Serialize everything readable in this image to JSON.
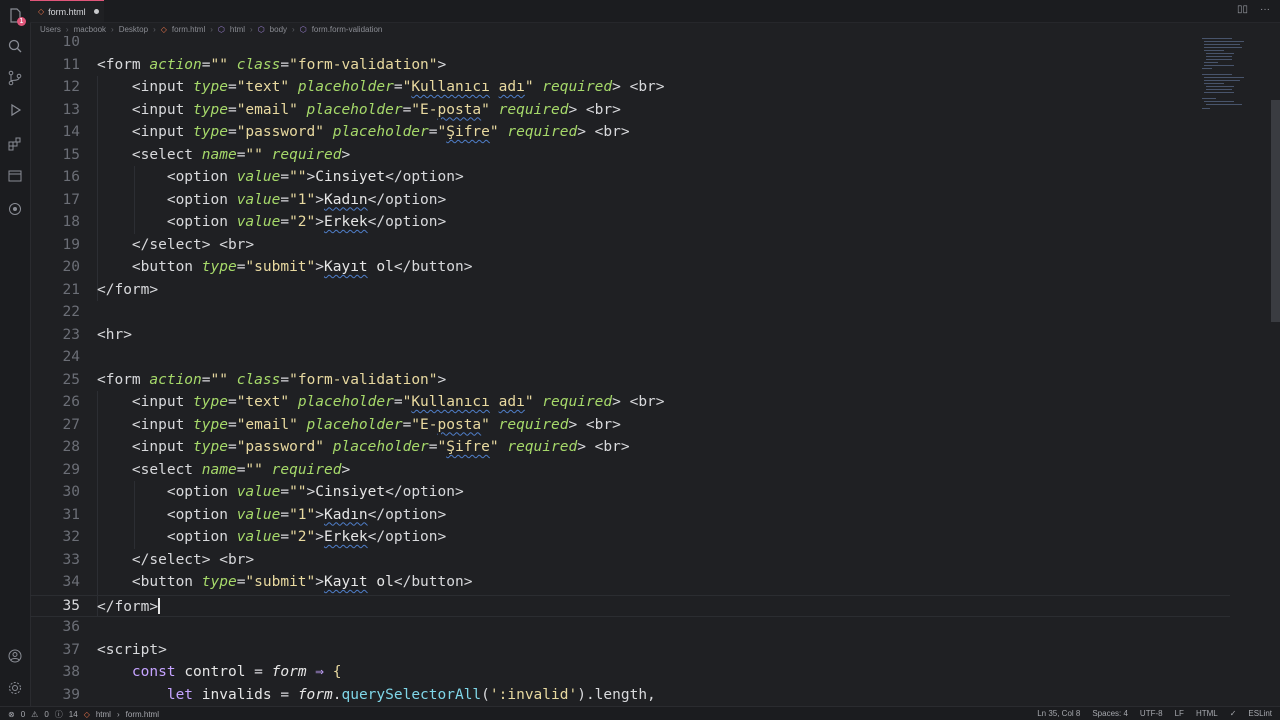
{
  "tab": {
    "filename": "form.html",
    "file_icon": "html-file-icon"
  },
  "breadcrumb": [
    "Users",
    "macbook",
    "Desktop",
    "form.html",
    "html",
    "body",
    "form.form-validation"
  ],
  "editor": {
    "lines": [
      {
        "n": "10",
        "html": ""
      },
      {
        "n": "11",
        "html": "<span class='t-tag'>&lt;form </span><span class='t-attr'>action</span><span class='t-punct'>=</span><span class='t-str'>\"\"</span> <span class='t-attr'>class</span><span class='t-punct'>=</span><span class='t-str'>\"form-validation\"</span><span class='t-tag'>&gt;</span>"
      },
      {
        "n": "12",
        "html": "    <span class='t-tag'>&lt;input </span><span class='t-attr'>type</span>=<span class='t-str'>\"text\"</span> <span class='t-attr'>placeholder</span>=<span class='t-str'>\"<span class='squiggle'>Kullanıcı</span> <span class='squiggle'>adı</span>\"</span> <span class='t-attr'>required</span><span class='t-tag'>&gt; &lt;br&gt;</span>"
      },
      {
        "n": "13",
        "html": "    <span class='t-tag'>&lt;input </span><span class='t-attr'>type</span>=<span class='t-str'>\"email\"</span> <span class='t-attr'>placeholder</span>=<span class='t-str'>\"E-<span class='squiggle'>posta</span>\"</span> <span class='t-attr'>required</span><span class='t-tag'>&gt; &lt;br&gt;</span>"
      },
      {
        "n": "14",
        "html": "    <span class='t-tag'>&lt;input </span><span class='t-attr'>type</span>=<span class='t-str'>\"password\"</span> <span class='t-attr'>placeholder</span>=<span class='t-str'>\"<span class='squiggle'>Şifre</span>\"</span> <span class='t-attr'>required</span><span class='t-tag'>&gt; &lt;br&gt;</span>"
      },
      {
        "n": "15",
        "html": "    <span class='t-tag'>&lt;select </span><span class='t-attr'>name</span>=<span class='t-str'>\"\"</span> <span class='t-attr'>required</span><span class='t-tag'>&gt;</span>"
      },
      {
        "n": "16",
        "html": "        <span class='t-tag'>&lt;option </span><span class='t-attr'>value</span>=<span class='t-str'>\"\"</span><span class='t-tag'>&gt;</span><span class='t-text'>Cinsiyet</span><span class='t-tag'>&lt;/option&gt;</span>"
      },
      {
        "n": "17",
        "html": "        <span class='t-tag'>&lt;option </span><span class='t-attr'>value</span>=<span class='t-str'>\"1\"</span><span class='t-tag'>&gt;</span><span class='t-text squiggle'>Kadın</span><span class='t-tag'>&lt;/option&gt;</span>"
      },
      {
        "n": "18",
        "html": "        <span class='t-tag'>&lt;option </span><span class='t-attr'>value</span>=<span class='t-str'>\"2\"</span><span class='t-tag'>&gt;</span><span class='t-text squiggle'>Erkek</span><span class='t-tag'>&lt;/option&gt;</span>"
      },
      {
        "n": "19",
        "html": "    <span class='t-tag'>&lt;/select&gt; &lt;br&gt;</span>"
      },
      {
        "n": "20",
        "html": "    <span class='t-tag'>&lt;button </span><span class='t-attr'>type</span>=<span class='t-str'>\"submit\"</span><span class='t-tag'>&gt;</span><span class='t-text'><span class='squiggle'>Kayıt</span> ol</span><span class='t-tag'>&lt;/button&gt;</span>"
      },
      {
        "n": "21",
        "html": "<span class='t-tag'>&lt;/form&gt;</span>"
      },
      {
        "n": "22",
        "html": ""
      },
      {
        "n": "23",
        "html": "<span class='t-tag'>&lt;hr&gt;</span>"
      },
      {
        "n": "24",
        "html": ""
      },
      {
        "n": "25",
        "html": "<span class='t-tag'>&lt;form </span><span class='t-attr'>action</span><span class='t-punct'>=</span><span class='t-str'>\"\"</span> <span class='t-attr'>class</span><span class='t-punct'>=</span><span class='t-str'>\"form-validation\"</span><span class='t-tag'>&gt;</span>"
      },
      {
        "n": "26",
        "html": "    <span class='t-tag'>&lt;input </span><span class='t-attr'>type</span>=<span class='t-str'>\"text\"</span> <span class='t-attr'>placeholder</span>=<span class='t-str'>\"<span class='squiggle'>Kullanıcı</span> <span class='squiggle'>adı</span>\"</span> <span class='t-attr'>required</span><span class='t-tag'>&gt; &lt;br&gt;</span>"
      },
      {
        "n": "27",
        "html": "    <span class='t-tag'>&lt;input </span><span class='t-attr'>type</span>=<span class='t-str'>\"email\"</span> <span class='t-attr'>placeholder</span>=<span class='t-str'>\"E-<span class='squiggle'>posta</span>\"</span> <span class='t-attr'>required</span><span class='t-tag'>&gt; &lt;br&gt;</span>"
      },
      {
        "n": "28",
        "html": "    <span class='t-tag'>&lt;input </span><span class='t-attr'>type</span>=<span class='t-str'>\"password\"</span> <span class='t-attr'>placeholder</span>=<span class='t-str'>\"<span class='squiggle'>Şifre</span>\"</span> <span class='t-attr'>required</span><span class='t-tag'>&gt; &lt;br&gt;</span>"
      },
      {
        "n": "29",
        "html": "    <span class='t-tag'>&lt;select </span><span class='t-attr'>name</span>=<span class='t-str'>\"\"</span> <span class='t-attr'>required</span><span class='t-tag'>&gt;</span>"
      },
      {
        "n": "30",
        "html": "        <span class='t-tag'>&lt;option </span><span class='t-attr'>value</span>=<span class='t-str'>\"\"</span><span class='t-tag'>&gt;</span><span class='t-text'>Cinsiyet</span><span class='t-tag'>&lt;/option&gt;</span>"
      },
      {
        "n": "31",
        "html": "        <span class='t-tag'>&lt;option </span><span class='t-attr'>value</span>=<span class='t-str'>\"1\"</span><span class='t-tag'>&gt;</span><span class='t-text squiggle'>Kadın</span><span class='t-tag'>&lt;/option&gt;</span>"
      },
      {
        "n": "32",
        "html": "        <span class='t-tag'>&lt;option </span><span class='t-attr'>value</span>=<span class='t-str'>\"2\"</span><span class='t-tag'>&gt;</span><span class='t-text squiggle'>Erkek</span><span class='t-tag'>&lt;/option&gt;</span>"
      },
      {
        "n": "33",
        "html": "    <span class='t-tag'>&lt;/select&gt; &lt;br&gt;</span>"
      },
      {
        "n": "34",
        "html": "    <span class='t-tag'>&lt;button </span><span class='t-attr'>type</span>=<span class='t-str'>\"submit\"</span><span class='t-tag'>&gt;</span><span class='t-text'><span class='squiggle'>Kayıt</span> ol</span><span class='t-tag'>&lt;/button&gt;</span>"
      },
      {
        "n": "35",
        "html": "<span class='t-tag'>&lt;/form&gt;</span><span class='cursor'></span>",
        "current": true
      },
      {
        "n": "36",
        "html": ""
      },
      {
        "n": "37",
        "html": "<span class='t-tag'>&lt;script&gt;</span>"
      },
      {
        "n": "38",
        "html": "    <span class='t-kw'>const</span> <span class='t-var'>control</span> <span class='t-punct'>=</span> <span class='t-it'>form</span> <span class='t-kw'>⇒</span> <span class='t-str'>{</span>"
      },
      {
        "n": "39",
        "html": "        <span class='t-kw'>let</span> <span class='t-var'>invalids</span> <span class='t-punct'>=</span> <span class='t-it'>form</span>.<span class='t-fn'>querySelectorAll</span>(<span class='t-str'>':invalid'</span>).length,"
      }
    ]
  },
  "statusbar": {
    "left": {
      "errors": "0",
      "warnings": "0",
      "info": "14",
      "lang_crumb": "html",
      "file_crumb": "form.html"
    },
    "right": {
      "position": "Ln 35, Col 8",
      "spaces": "Spaces: 4",
      "encoding": "UTF-8",
      "eol": "LF",
      "language": "HTML",
      "linter": "ESLint"
    }
  },
  "colors": {
    "accent": "#e0567a",
    "background": "#1f2023"
  }
}
